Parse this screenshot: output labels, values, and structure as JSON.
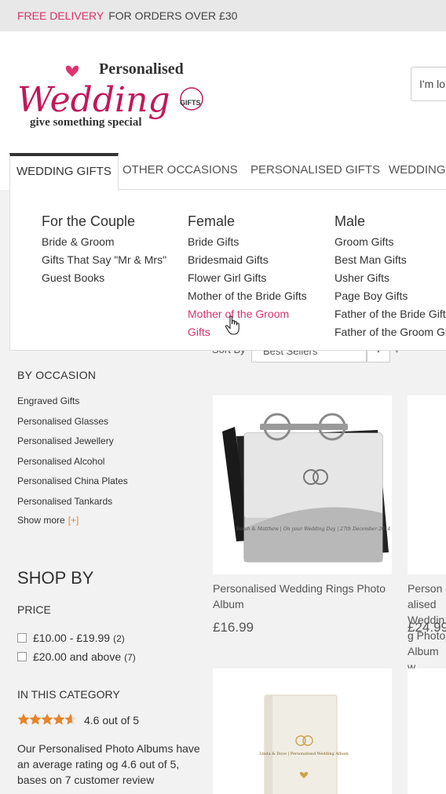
{
  "topbar": {
    "highlight": "FREE DELIVERY",
    "rest": "FOR ORDERS OVER £30"
  },
  "logo": {
    "line1": "Personalised",
    "line2": "Wedding",
    "badge": "GIFTS",
    "tagline": "give something special"
  },
  "search": {
    "value": "I'm lo"
  },
  "nav": {
    "tabs": [
      {
        "label": "WEDDING GIFTS"
      },
      {
        "label": "OTHER OCCASIONS"
      },
      {
        "label": "PERSONALISED GIFTS"
      },
      {
        "label": "WEDDING"
      }
    ]
  },
  "mega": {
    "columns": [
      {
        "title": "For the Couple",
        "items": [
          "Bride & Groom",
          "Gifts That Say \"Mr & Mrs\"",
          "Guest Books"
        ]
      },
      {
        "title": "Female",
        "items": [
          "Bride Gifts",
          "Bridesmaid Gifts",
          "Flower Girl Gifts",
          "Mother of the Bride Gifts",
          "Mother of the Groom",
          "Gifts"
        ]
      },
      {
        "title": "Male",
        "items": [
          "Groom Gifts",
          "Best Man Gifts",
          "Usher Gifts",
          "Page Boy Gifts",
          "Father of the Bride Gifts",
          "Father of the Groom Gifts"
        ]
      }
    ],
    "hover_color": "#d6336c"
  },
  "sort": {
    "label": "Sort By",
    "value": "Best Sellers"
  },
  "sidebar": {
    "by_occasion": "BY OCCASION",
    "occasions": [
      "Engraved Gifts",
      "Personalised Glasses",
      "Personalised Jewellery",
      "Personalised Alcohol",
      "Personalised China Plates",
      "Personalised Tankards"
    ],
    "show_more": "Show more",
    "show_more_icon": "[+]",
    "shop_by": "SHOP BY",
    "price_heading": "PRICE",
    "price_filters": [
      {
        "label": "£10.00 - £19.99",
        "count": "(2)"
      },
      {
        "label": "£20.00 and above",
        "count": "(7)"
      }
    ],
    "category_heading": "IN THIS CATEGORY",
    "rating": 4.6,
    "rating_text": "4.6 out of 5",
    "blurb": "Our Personalised Photo Albums have an average rating og 4.6 out of 5, bases on 7 customer review"
  },
  "products": [
    {
      "name": "Personalised Wedding Rings Photo Album",
      "price": "£16.99",
      "engraving": "Sarah & Matthew | On your Wedding Day | 27th December 2014"
    },
    {
      "name": "Personalised Wedding Photo Album w",
      "price": "£24.99"
    },
    {
      "name": "",
      "price": "",
      "engraving": "Linda & Dave | Personalised Wedding Album"
    }
  ],
  "colors": {
    "accent": "#d6336c",
    "star": "#e8842b"
  }
}
